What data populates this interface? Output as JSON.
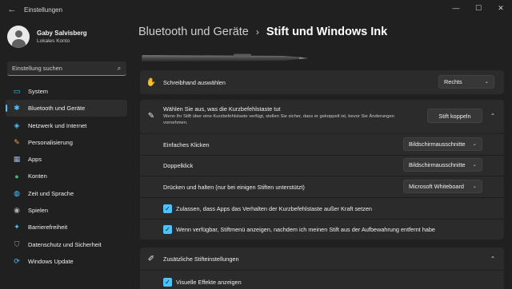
{
  "window": {
    "title": "Einstellungen",
    "back_icon": "←",
    "minimize": "—",
    "maximize": "☐",
    "close": "✕"
  },
  "profile": {
    "name": "Gaby Salvisberg",
    "account": "Lokales Konto"
  },
  "search": {
    "placeholder": "Einstellung suchen",
    "icon": "⌕"
  },
  "sidebar": {
    "items": [
      {
        "label": "System",
        "icon": "system-icon",
        "glyph": "▭",
        "color": "#4cc2ff"
      },
      {
        "label": "Bluetooth und Geräte",
        "icon": "bluetooth-icon",
        "glyph": "✱",
        "color": "#4cc2ff",
        "active": true
      },
      {
        "label": "Netzwerk und Internet",
        "icon": "wifi-icon",
        "glyph": "◈",
        "color": "#4cc2ff"
      },
      {
        "label": "Personalisierung",
        "icon": "brush-icon",
        "glyph": "✎",
        "color": "#f0a04b"
      },
      {
        "label": "Apps",
        "icon": "apps-icon",
        "glyph": "▦",
        "color": "#9fb4d8"
      },
      {
        "label": "Konten",
        "icon": "accounts-icon",
        "glyph": "●",
        "color": "#3fb97b"
      },
      {
        "label": "Zeit und Sprache",
        "icon": "globe-icon",
        "glyph": "◍",
        "color": "#4cc2ff"
      },
      {
        "label": "Spielen",
        "icon": "gamepad-icon",
        "glyph": "◉",
        "color": "#b0b0b0"
      },
      {
        "label": "Barrierefreiheit",
        "icon": "accessibility-icon",
        "glyph": "✦",
        "color": "#4cc2ff"
      },
      {
        "label": "Datenschutz und Sicherheit",
        "icon": "shield-icon",
        "glyph": "⛉",
        "color": "#9a9a9a"
      },
      {
        "label": "Windows Update",
        "icon": "update-icon",
        "glyph": "⟳",
        "color": "#4cc2ff"
      }
    ]
  },
  "breadcrumb": {
    "parent": "Bluetooth und Geräte",
    "separator": "›",
    "current": "Stift und Windows Ink"
  },
  "handwriting": {
    "label": "Schreibhand auswählen",
    "icon": "hand-icon",
    "value": "Rechts"
  },
  "shortcut": {
    "title": "Wählen Sie aus, was die Kurzbefehlstaste tut",
    "description": "Wenn Ihr Stift über eine Kurzbefehlstaste verfügt, stellen Sie sicher, dass er gekoppelt ist, bevor Sie Änderungen vornehmen.",
    "pair_button": "Stift koppeln",
    "rows": [
      {
        "label": "Einfaches Klicken",
        "value": "Bildschirmausschnitte"
      },
      {
        "label": "Doppelklick",
        "value": "Bildschirmausschnitte"
      },
      {
        "label": "Drücken und halten (nur bei einigen Stiften unterstützt)",
        "value": "Microsoft Whiteboard"
      }
    ],
    "checkboxes": [
      {
        "label": "Zulassen, dass Apps das Verhalten der Kurzbefehlstaste außer Kraft setzen",
        "checked": true
      },
      {
        "label": "Wenn verfügbar, Stiftmenü anzeigen, nachdem ich meinen Stift aus der Aufbewahrung entfernt habe",
        "checked": true
      }
    ]
  },
  "additional": {
    "title": "Zusätzliche Stifteinstellungen",
    "checkboxes": [
      {
        "label": "Visuelle Effekte anzeigen",
        "checked": true
      }
    ]
  },
  "glyphs": {
    "chevron_down": "⌄",
    "chevron_up": "⌃",
    "check": "✓"
  },
  "colors": {
    "accent": "#4cc2ff",
    "background": "#202020",
    "card": "#2b2b2b"
  }
}
